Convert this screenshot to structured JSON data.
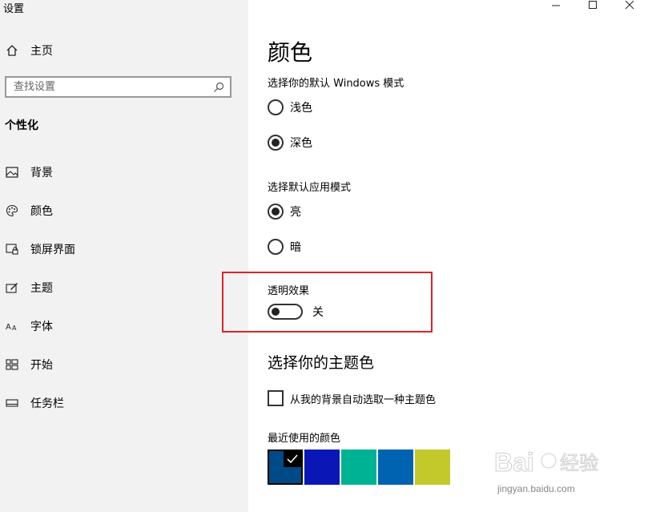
{
  "window": {
    "title": "设置"
  },
  "sidebar": {
    "home_label": "主页",
    "search_placeholder": "查找设置",
    "section_heading": "个性化",
    "items": [
      {
        "label": "背景",
        "icon": "image-icon"
      },
      {
        "label": "颜色",
        "icon": "palette-icon"
      },
      {
        "label": "锁屏界面",
        "icon": "lock-screen-icon"
      },
      {
        "label": "主题",
        "icon": "theme-brush-icon"
      },
      {
        "label": "字体",
        "icon": "font-icon"
      },
      {
        "label": "开始",
        "icon": "start-grid-icon"
      },
      {
        "label": "任务栏",
        "icon": "taskbar-icon"
      }
    ]
  },
  "main": {
    "title": "颜色",
    "windows_mode": {
      "label": "选择你的默认 Windows 模式",
      "options": [
        {
          "label": "浅色",
          "selected": false
        },
        {
          "label": "深色",
          "selected": true
        }
      ]
    },
    "app_mode": {
      "label": "选择默认应用模式",
      "options": [
        {
          "label": "亮",
          "selected": true
        },
        {
          "label": "暗",
          "selected": false
        }
      ]
    },
    "transparency": {
      "label": "透明效果",
      "state_label": "关",
      "on": false
    },
    "accent": {
      "title": "选择你的主题色",
      "auto_pick_label": "从我的背景自动选取一种主题色",
      "auto_pick_checked": false,
      "recent_label": "最近使用的颜色",
      "recent_colors": [
        "#004b87",
        "#0a17b6",
        "#00b294",
        "#0063b1",
        "#c3c92a"
      ],
      "selected_index": 0
    }
  },
  "watermark": {
    "text": "jingyan.baidu.com",
    "logo": "Bai经验"
  },
  "colors": {
    "highlight_border": "#d9262a",
    "sidebar_bg": "#f2f2f2"
  }
}
